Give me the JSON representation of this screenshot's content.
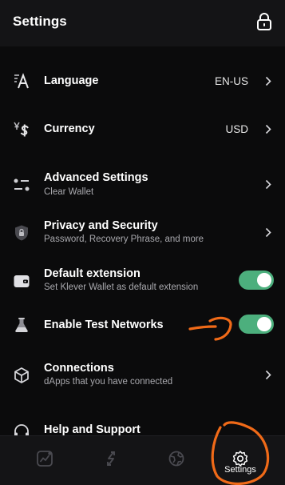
{
  "header": {
    "title": "Settings",
    "lock_icon": "lock-icon"
  },
  "items": [
    {
      "label": "Language",
      "value": "EN-US",
      "icon": "language-icon"
    },
    {
      "label": "Currency",
      "value": "USD",
      "icon": "currency-icon"
    },
    {
      "label": "Advanced Settings",
      "sub": "Clear Wallet",
      "icon": "sliders-icon"
    },
    {
      "label": "Privacy and Security",
      "sub": "Password, Recovery Phrase, and more",
      "icon": "shield-icon"
    },
    {
      "label": "Default extension",
      "sub": "Set Klever Wallet as default extension",
      "icon": "wallet-icon",
      "toggle": true
    },
    {
      "label": "Enable Test Networks",
      "icon": "flask-icon",
      "toggle": true
    },
    {
      "label": "Connections",
      "sub": "dApps that you have connected",
      "icon": "cube-icon"
    },
    {
      "label": "Help and Support",
      "icon": "headphones-icon"
    }
  ],
  "toggles": {
    "default_extension": true,
    "enable_test_networks": true
  },
  "bottom_nav": {
    "items": [
      {
        "name": "portfolio",
        "icon": "chart-icon"
      },
      {
        "name": "swap",
        "icon": "swap-icon"
      },
      {
        "name": "explore",
        "icon": "globe-icon"
      },
      {
        "name": "settings",
        "label": "Settings",
        "icon": "gear-icon",
        "active": true
      }
    ]
  },
  "colors": {
    "background": "#0b0b0c",
    "header": "#141416",
    "toggle_on": "#4caf7d",
    "annotation": "#f06a18",
    "muted_text": "#a9a9ae"
  }
}
